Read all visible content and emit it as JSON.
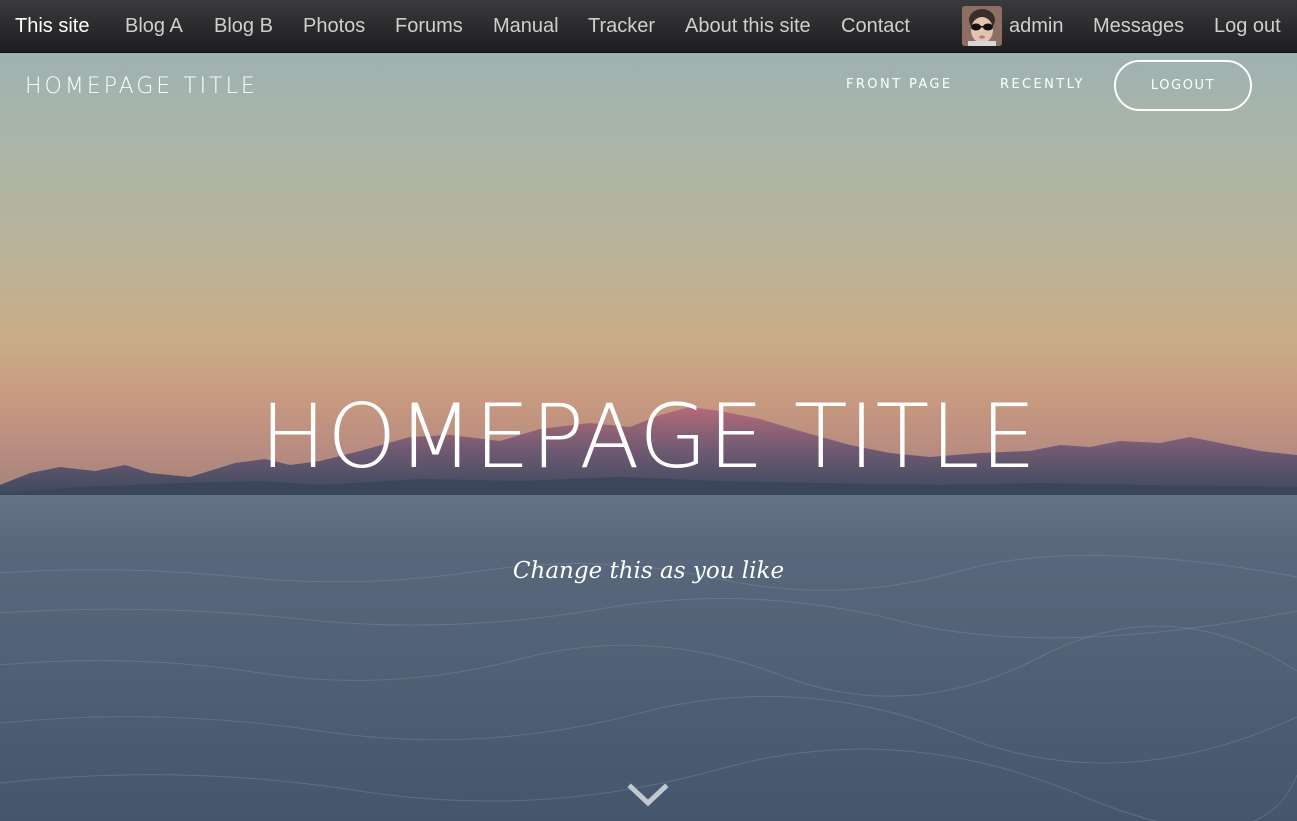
{
  "adminbar": {
    "left_items": [
      {
        "label": "This site"
      },
      {
        "label": "Blog A"
      },
      {
        "label": "Blog B"
      },
      {
        "label": "Photos"
      },
      {
        "label": "Forums"
      },
      {
        "label": "Manual"
      },
      {
        "label": "Tracker"
      },
      {
        "label": "About this site"
      },
      {
        "label": "Contact"
      }
    ],
    "user": {
      "name": "admin",
      "avatar_icon": "user-avatar"
    },
    "right_items": [
      {
        "label": "Messages"
      },
      {
        "label": "Log out"
      }
    ]
  },
  "header": {
    "site_title": "HOMEPAGE TITLE",
    "nav": [
      {
        "label": "FRONT PAGE"
      },
      {
        "label": "RECENTLY"
      }
    ],
    "logout_label": "LOGOUT"
  },
  "hero": {
    "title": "HOMEPAGE TITLE",
    "subtitle": "Change this as you like",
    "scroll_icon": "chevron-down-icon"
  },
  "colors": {
    "adminbar_bg": "#2a2a2c",
    "adminbar_text": "#cfcfcf",
    "sky_top": "#9fb2b1",
    "sky_horizon": "#c89a80",
    "salt_flat": "#4b5c72",
    "hero_text": "#ffffff"
  }
}
